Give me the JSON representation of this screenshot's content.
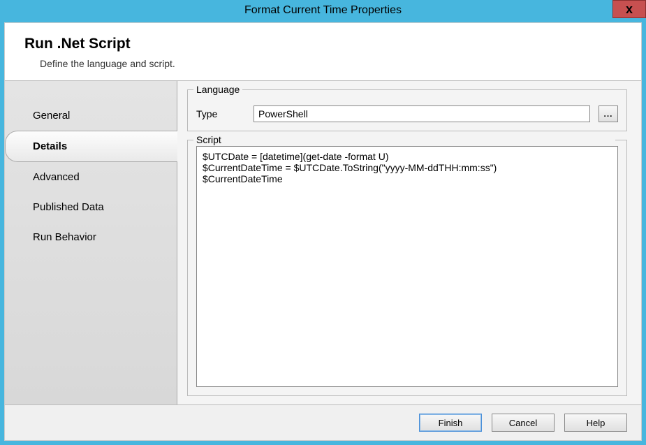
{
  "window": {
    "title": "Format Current Time Properties",
    "close_label": "x"
  },
  "header": {
    "title": "Run .Net Script",
    "description": "Define the language and script."
  },
  "sidebar": {
    "items": [
      {
        "label": "General",
        "active": false
      },
      {
        "label": "Details",
        "active": true
      },
      {
        "label": "Advanced",
        "active": false
      },
      {
        "label": "Published Data",
        "active": false
      },
      {
        "label": "Run Behavior",
        "active": false
      }
    ]
  },
  "language": {
    "legend": "Language",
    "type_label": "Type",
    "type_value": "PowerShell",
    "browse_label": "..."
  },
  "script": {
    "legend": "Script",
    "content": "$UTCDate = [datetime](get-date -format U)\n$CurrentDateTime = $UTCDate.ToString(\"yyyy-MM-ddTHH:mm:ss\")\n$CurrentDateTime"
  },
  "footer": {
    "finish": "Finish",
    "cancel": "Cancel",
    "help": "Help"
  }
}
